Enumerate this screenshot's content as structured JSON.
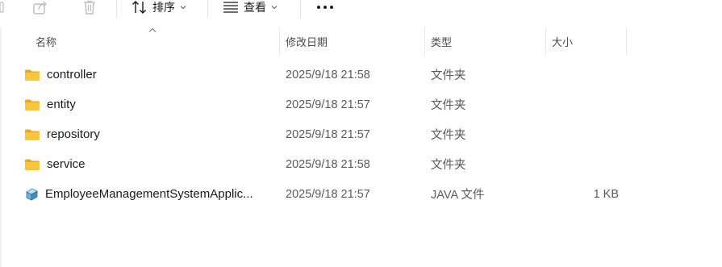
{
  "toolbar": {
    "sort_label": "排序",
    "view_label": "查看"
  },
  "columns": {
    "name": "名称",
    "modified": "修改日期",
    "type": "类型",
    "size": "大小"
  },
  "rows": [
    {
      "name": "controller",
      "modified": "2025/9/18 21:58",
      "type": "文件夹",
      "size": "",
      "icon": "folder-icon"
    },
    {
      "name": "entity",
      "modified": "2025/9/18 21:57",
      "type": "文件夹",
      "size": "",
      "icon": "folder-icon"
    },
    {
      "name": "repository",
      "modified": "2025/9/18 21:57",
      "type": "文件夹",
      "size": "",
      "icon": "folder-icon"
    },
    {
      "name": "service",
      "modified": "2025/9/18 21:58",
      "type": "文件夹",
      "size": "",
      "icon": "folder-icon"
    },
    {
      "name": "EmployeeManagementSystemApplic...",
      "modified": "2025/9/18 21:57",
      "type": "JAVA 文件",
      "size": "1 KB",
      "icon": "java-file-icon"
    }
  ],
  "colors": {
    "folder": "#F8C63C",
    "folder_dark": "#E8A91E",
    "text": "#1a1a1a",
    "muted": "#5a5a5a"
  }
}
